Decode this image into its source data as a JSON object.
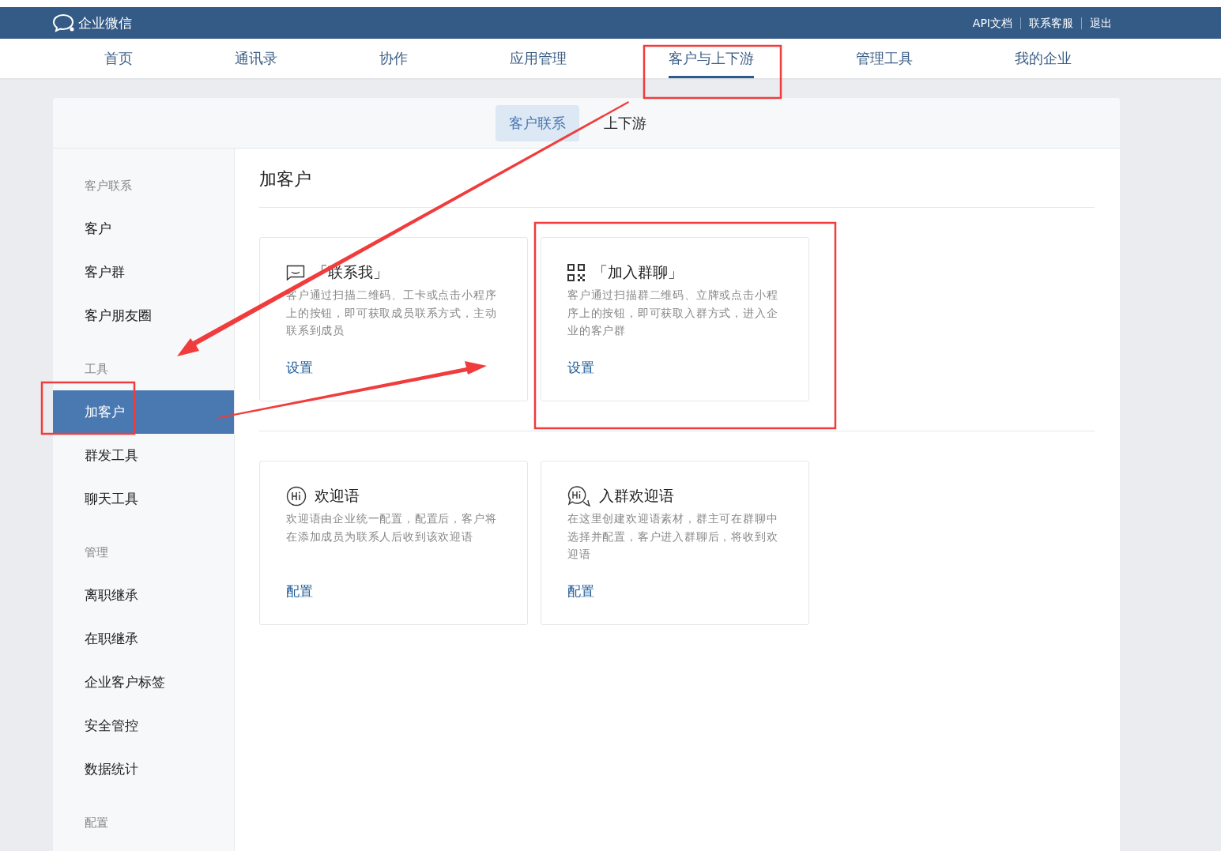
{
  "header": {
    "logo_text": "企业微信",
    "links": [
      "API文档",
      "联系客服",
      "退出"
    ]
  },
  "nav": [
    {
      "label": "首页",
      "selected": false
    },
    {
      "label": "通讯录",
      "selected": false
    },
    {
      "label": "协作",
      "selected": false
    },
    {
      "label": "应用管理",
      "selected": false
    },
    {
      "label": "客户与上下游",
      "selected": true
    },
    {
      "label": "管理工具",
      "selected": false
    },
    {
      "label": "我的企业",
      "selected": false
    }
  ],
  "subtabs": [
    {
      "label": "客户联系",
      "selected": true
    },
    {
      "label": "上下游",
      "selected": false
    }
  ],
  "sidebar": [
    {
      "title": "客户联系",
      "items": [
        {
          "label": "客户",
          "selected": false
        },
        {
          "label": "客户群",
          "selected": false
        },
        {
          "label": "客户朋友圈",
          "selected": false
        }
      ]
    },
    {
      "title": "工具",
      "items": [
        {
          "label": "加客户",
          "selected": true
        },
        {
          "label": "群发工具",
          "selected": false
        },
        {
          "label": "聊天工具",
          "selected": false
        }
      ]
    },
    {
      "title": "管理",
      "items": [
        {
          "label": "离职继承",
          "selected": false
        },
        {
          "label": "在职继承",
          "selected": false
        },
        {
          "label": "企业客户标签",
          "selected": false
        },
        {
          "label": "安全管控",
          "selected": false
        },
        {
          "label": "数据统计",
          "selected": false
        }
      ]
    },
    {
      "title": "配置"
    }
  ],
  "content": {
    "title": "加客户",
    "sections": [
      {
        "cards": [
          {
            "kind": "message",
            "title": "「联系我」",
            "description": "客户通过扫描二维码、工卡或点击小程序上的按钮，即可获取成员联系方式，主动联系到成员",
            "action": "设置"
          },
          {
            "kind": "qrcode",
            "title": "「加入群聊」",
            "description": "客户通过扫描群二维码、立牌或点击小程序上的按钮，即可获取入群方式，进入企业的客户群",
            "action": "设置"
          }
        ]
      },
      {
        "cards": [
          {
            "kind": "hi",
            "title": "欢迎语",
            "description": "欢迎语由企业统一配置，配置后，客户将在添加成员为联系人后收到该欢迎语",
            "action": "配置"
          },
          {
            "kind": "hi-chat",
            "title": "入群欢迎语",
            "description": "在这里创建欢迎语素材，群主可在群聊中选择并配置，客户进入群聊后，将收到欢迎语",
            "action": "配置"
          }
        ]
      }
    ]
  }
}
